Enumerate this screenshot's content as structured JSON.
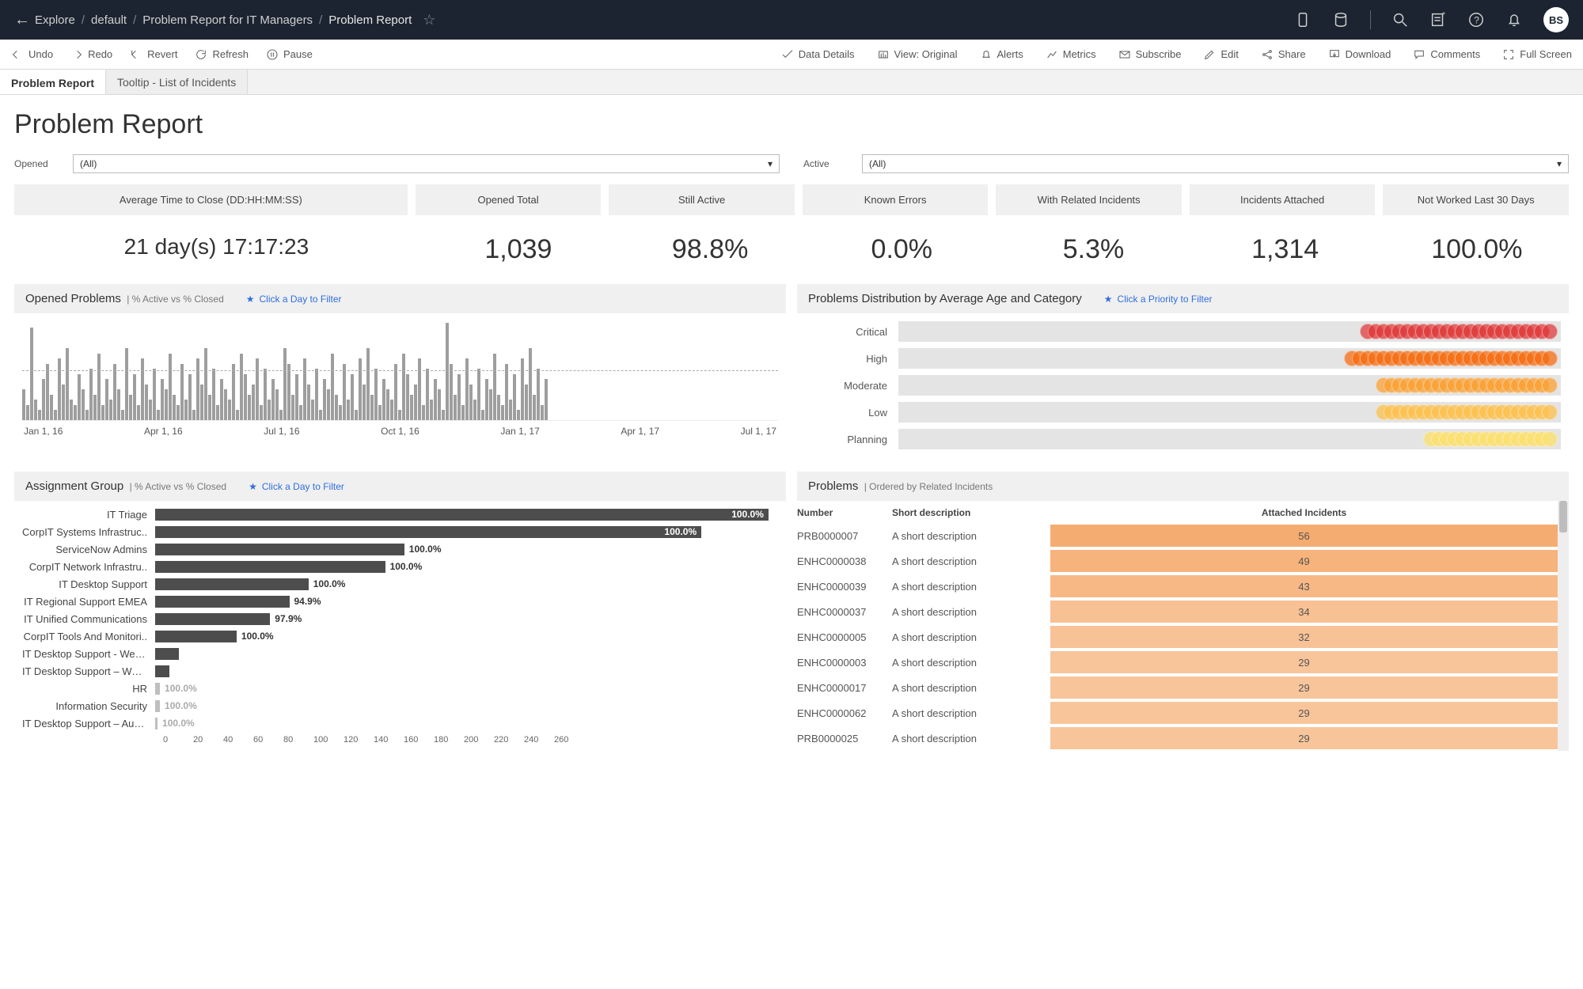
{
  "nav": {
    "breadcrumb": [
      "Explore",
      "default",
      "Problem Report for IT Managers",
      "Problem Report"
    ],
    "avatar": "BS"
  },
  "toolbar": {
    "undo": "Undo",
    "redo": "Redo",
    "revert": "Revert",
    "refresh": "Refresh",
    "pause": "Pause",
    "dataDetails": "Data Details",
    "view": "View: Original",
    "alerts": "Alerts",
    "metrics": "Metrics",
    "subscribe": "Subscribe",
    "edit": "Edit",
    "share": "Share",
    "download": "Download",
    "comments": "Comments",
    "fullscreen": "Full Screen"
  },
  "sheets": {
    "active": "Problem Report",
    "other": "Tooltip - List of Incidents"
  },
  "page": {
    "title": "Problem Report",
    "filters": {
      "opened_label": "Opened",
      "opened_value": "(All)",
      "active_label": "Active",
      "active_value": "(All)"
    }
  },
  "kpis": {
    "labels": [
      "Average Time to Close (DD:HH:MM:SS)",
      "Opened Total",
      "Still Active",
      "Known Errors",
      "With Related Incidents",
      "Incidents Attached",
      "Not Worked Last 30 Days"
    ],
    "values": [
      "21 day(s) 17:17:23",
      "1,039",
      "98.8%",
      "0.0%",
      "5.3%",
      "1,314",
      "100.0%"
    ]
  },
  "panel_headers": {
    "opened": "Opened Problems",
    "opened_sub": "| % Active vs % Closed",
    "opened_hint": "Click a Day to Filter",
    "dist": "Problems Distribution by Average Age and Category",
    "dist_hint": "Click a Priority to Filter",
    "assign": "Assignment Group",
    "assign_sub": "| % Active vs % Closed",
    "assign_hint": "Click a Day to Filter",
    "problems": "Problems",
    "problems_sub": "| Ordered by Related Incidents"
  },
  "chart_data": [
    {
      "type": "bar",
      "id": "opened_problems_timeline",
      "title": "Opened Problems | % Active vs % Closed",
      "x_ticks": [
        "Jan 1, 16",
        "Apr 1, 16",
        "Jul 1, 16",
        "Oct 1, 16",
        "Jan 1, 17",
        "Apr 1, 17",
        "Jul 1, 17"
      ],
      "note": "daily counts approximate — read as relative heights",
      "values": [
        30,
        15,
        90,
        20,
        10,
        40,
        55,
        25,
        10,
        60,
        35,
        70,
        20,
        15,
        45,
        30,
        10,
        50,
        25,
        65,
        15,
        40,
        20,
        55,
        30,
        10,
        70,
        25,
        45,
        15,
        60,
        35,
        20,
        50,
        10,
        40,
        30,
        65,
        25,
        15,
        55,
        20,
        45,
        10,
        60,
        35,
        70,
        25,
        50,
        15,
        40,
        30,
        20,
        55,
        10,
        65,
        45,
        25,
        35,
        60,
        15,
        50,
        20,
        40,
        30,
        10,
        70,
        55,
        25,
        45,
        15,
        60,
        35,
        20,
        50,
        10,
        40,
        30,
        65,
        25,
        15,
        55,
        20,
        45,
        10,
        60,
        35,
        70,
        25,
        50,
        15,
        40,
        30,
        20,
        55,
        10,
        65,
        45,
        25,
        35,
        60,
        15,
        50,
        20,
        40,
        30,
        10,
        95,
        55,
        25,
        45,
        15,
        60,
        35,
        20,
        50,
        10,
        40,
        30,
        65,
        25,
        15,
        55,
        20,
        45,
        10,
        60,
        35,
        70,
        25,
        50,
        15,
        40
      ]
    },
    {
      "type": "scatter",
      "id": "distribution_by_age_category",
      "title": "Problems Distribution by Average Age and Category",
      "categories": [
        {
          "name": "Critical",
          "color": "#e03131",
          "count": 24
        },
        {
          "name": "High",
          "color": "#f76707",
          "count": 26
        },
        {
          "name": "Moderate",
          "color": "#fd9e2b",
          "count": 22
        },
        {
          "name": "Low",
          "color": "#ffc046",
          "count": 22
        },
        {
          "name": "Planning",
          "color": "#ffe066",
          "count": 16
        }
      ],
      "x_note": "dots clustered at upper end of average-age axis"
    },
    {
      "type": "bar",
      "id": "assignment_group",
      "title": "Assignment Group | % Active vs % Closed",
      "xlabel": "",
      "ylabel": "",
      "x_ticks": [
        0,
        20,
        40,
        60,
        80,
        100,
        120,
        140,
        160,
        180,
        200,
        220,
        240,
        260
      ],
      "series": [
        {
          "name": "IT Triage",
          "value": 256,
          "pct": "100.0%"
        },
        {
          "name": "CorpIT Systems Infrastruc..",
          "value": 228,
          "pct": "100.0%"
        },
        {
          "name": "ServiceNow Admins",
          "value": 104,
          "pct": "100.0%"
        },
        {
          "name": "CorpIT Network Infrastru..",
          "value": 96,
          "pct": "100.0%"
        },
        {
          "name": "IT Desktop Support",
          "value": 64,
          "pct": "100.0%"
        },
        {
          "name": "IT Regional Support EMEA",
          "value": 56,
          "pct": "94.9%"
        },
        {
          "name": "IT Unified Communications",
          "value": 48,
          "pct": "97.9%"
        },
        {
          "name": "CorpIT Tools And Monitori..",
          "value": 34,
          "pct": "100.0%"
        },
        {
          "name": "IT Desktop Support - West..",
          "value": 10,
          "pct": ""
        },
        {
          "name": "IT Desktop Support – Wes..",
          "value": 6,
          "pct": ""
        },
        {
          "name": "HR",
          "value": 2,
          "pct": "100.0%"
        },
        {
          "name": "Information Security",
          "value": 2,
          "pct": "100.0%"
        },
        {
          "name": "IT Desktop Support – Aust..",
          "value": 1,
          "pct": "100.0%"
        }
      ]
    },
    {
      "type": "table",
      "id": "problems_by_incidents",
      "title": "Problems | Ordered by Related Incidents",
      "columns": [
        "Number",
        "Short description",
        "Attached Incidents"
      ],
      "rows": [
        [
          "PRB0000007",
          "A short description",
          56
        ],
        [
          "ENHC0000038",
          "A short description",
          49
        ],
        [
          "ENHC0000039",
          "A short description",
          43
        ],
        [
          "ENHC0000037",
          "A short description",
          34
        ],
        [
          "ENHC0000005",
          "A short description",
          32
        ],
        [
          "ENHC0000003",
          "A short description",
          29
        ],
        [
          "ENHC0000017",
          "A short description",
          29
        ],
        [
          "ENHC0000062",
          "A short description",
          29
        ],
        [
          "PRB0000025",
          "A short description",
          29
        ]
      ],
      "heat_max": 56,
      "heat_color": "#f4b97a"
    }
  ]
}
